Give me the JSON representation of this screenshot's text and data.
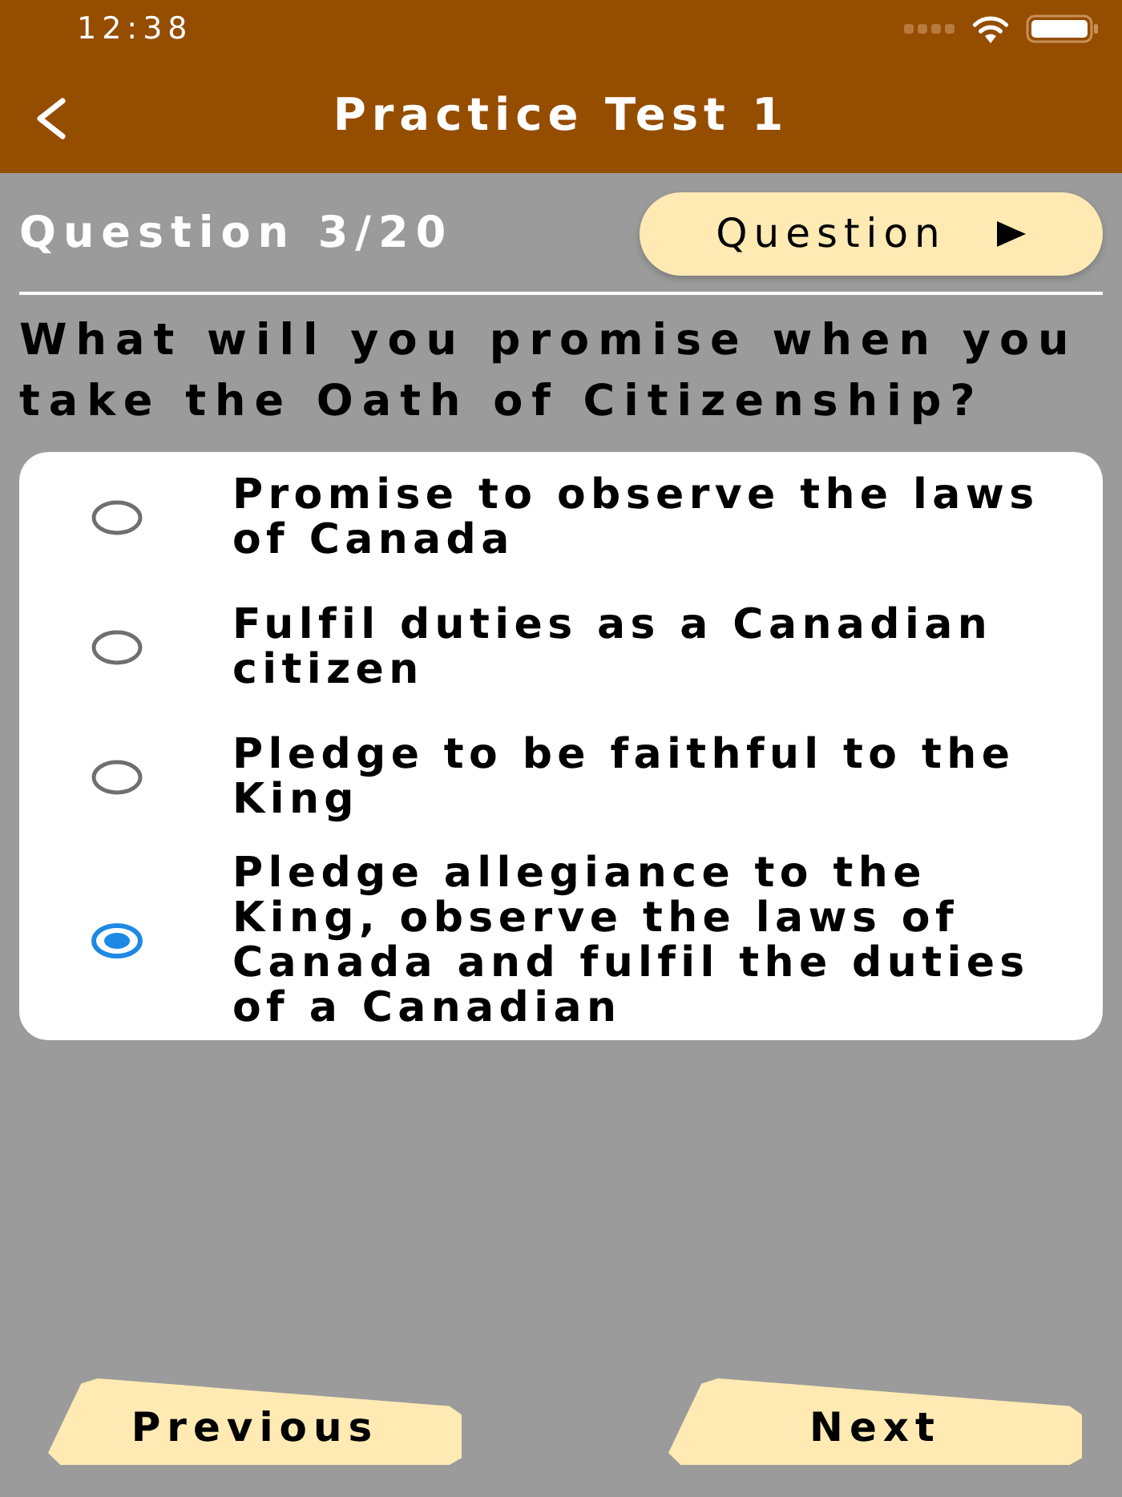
{
  "status_bar": {
    "time": "12:38"
  },
  "nav": {
    "title": "Practice Test 1"
  },
  "question_header": {
    "counter": "Question 3/20",
    "question_button": {
      "label": "Question"
    }
  },
  "question": {
    "text": "What will you promise when you take the Oath of Citizenship?"
  },
  "options": [
    {
      "text": "Promise to observe the laws of Canada",
      "selected": false
    },
    {
      "text": "Fulfil duties as a Canadian citizen",
      "selected": false
    },
    {
      "text": "Pledge to be faithful to the King",
      "selected": false
    },
    {
      "text": "Pledge allegiance to the King, observe the laws of Canada and fulfil the duties of a Canadian",
      "selected": true
    }
  ],
  "footer": {
    "buttons": [
      {
        "label": "Previous"
      },
      {
        "label": "Next"
      }
    ]
  }
}
